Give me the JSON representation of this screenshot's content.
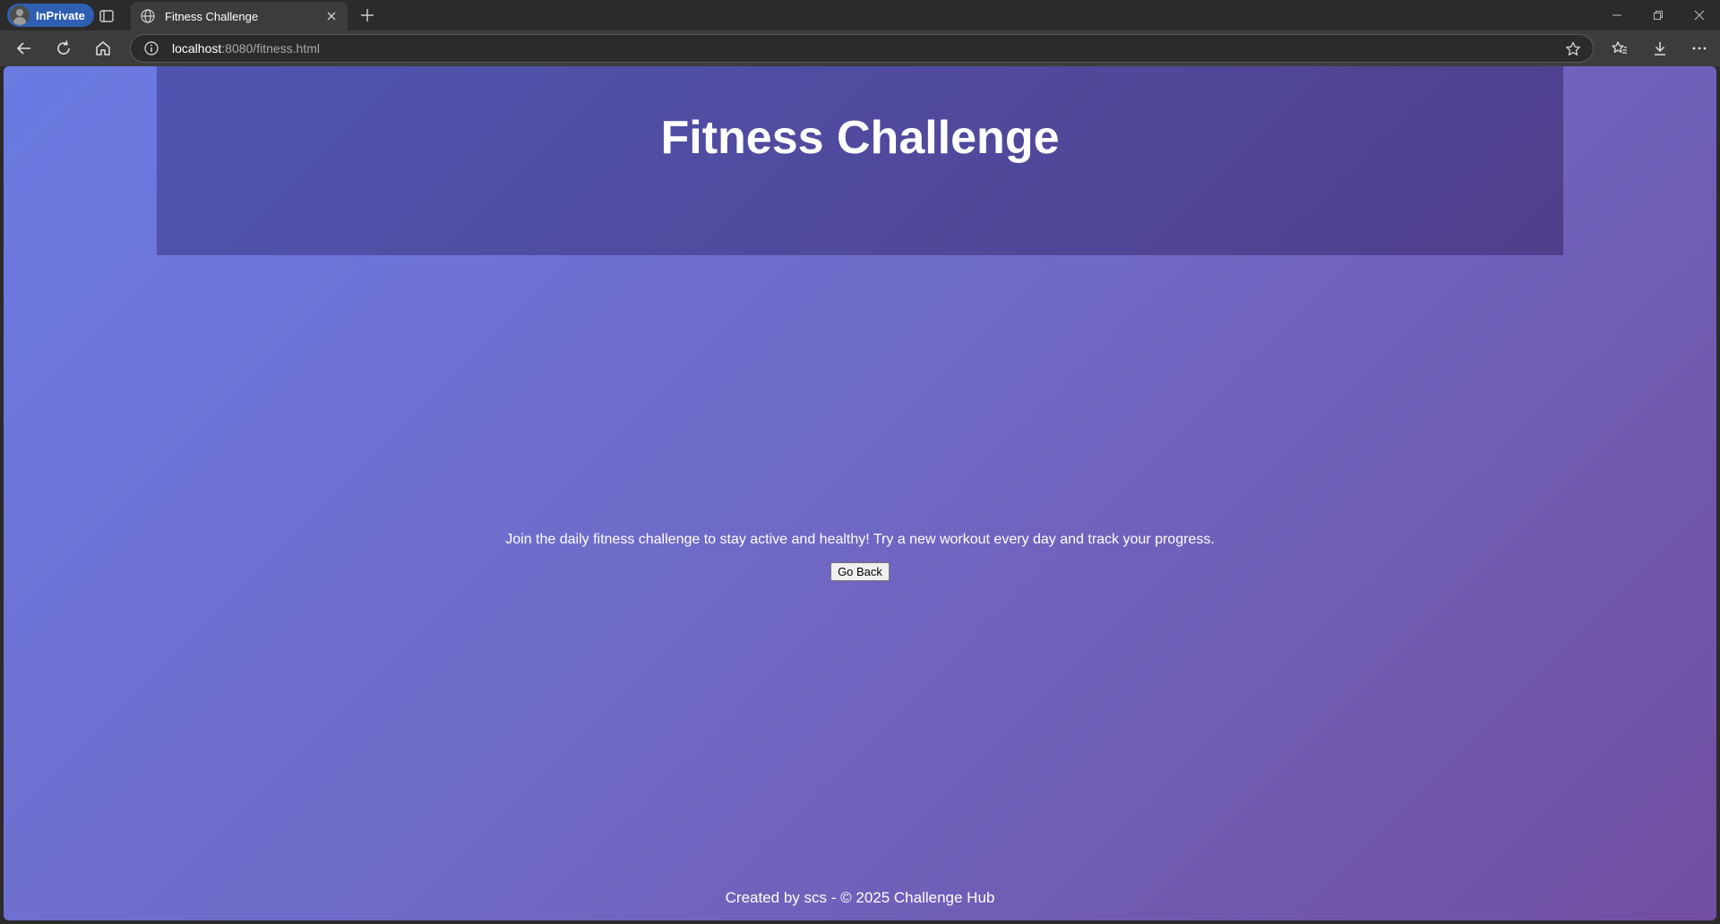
{
  "browser": {
    "profile_label": "InPrivate",
    "tab": {
      "title": "Fitness Challenge"
    },
    "address": {
      "host": "localhost",
      "rest": ":8080/fitness.html"
    }
  },
  "page": {
    "title": "Fitness Challenge",
    "description": "Join the daily fitness challenge to stay active and healthy! Try a new workout every day and track your progress.",
    "go_back_label": "Go Back",
    "footer": "Created by scs - © 2025 Challenge Hub"
  },
  "colors": {
    "gradient_start": "#6b7be3",
    "gradient_end": "#714fa1",
    "inprivate_badge": "#2f5fb2"
  }
}
